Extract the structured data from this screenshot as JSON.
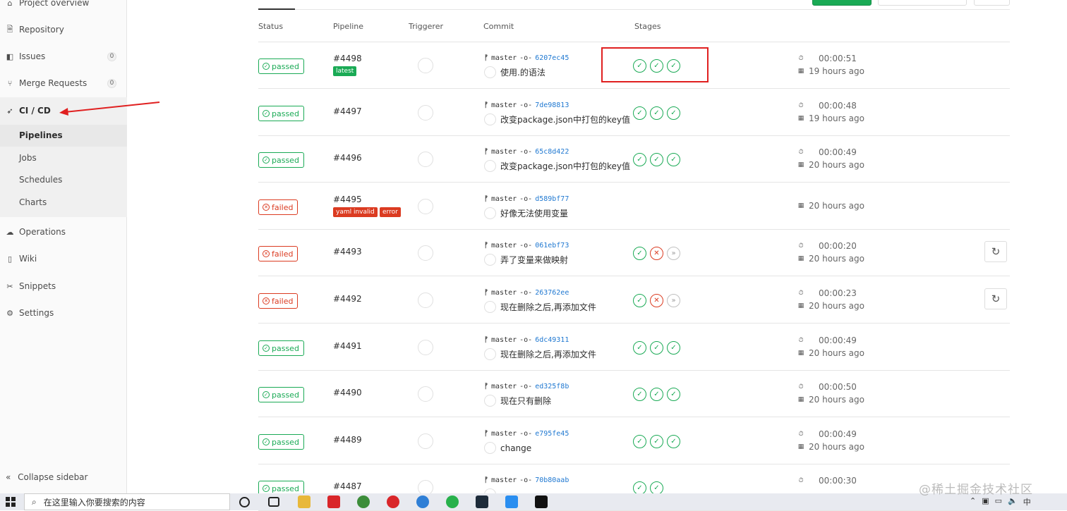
{
  "sidebar": {
    "items": [
      {
        "label": "Project overview",
        "icon": "home-icon"
      },
      {
        "label": "Repository",
        "icon": "document-icon"
      },
      {
        "label": "Issues",
        "icon": "issues-icon",
        "count": "0"
      },
      {
        "label": "Merge Requests",
        "icon": "merge-request-icon",
        "count": "0"
      },
      {
        "label": "CI / CD",
        "icon": "rocket-icon"
      },
      {
        "label": "Operations",
        "icon": "cloud-icon"
      },
      {
        "label": "Wiki",
        "icon": "book-icon"
      },
      {
        "label": "Snippets",
        "icon": "scissors-icon"
      },
      {
        "label": "Settings",
        "icon": "gear-icon"
      }
    ],
    "cicd_sub": [
      "Pipelines",
      "Jobs",
      "Schedules",
      "Charts"
    ],
    "collapse_label": "Collapse sidebar"
  },
  "table": {
    "headers": [
      "Status",
      "Pipeline",
      "Triggerer",
      "Commit",
      "Stages"
    ],
    "rows": [
      {
        "status": "passed",
        "id": "#4498",
        "tags": [
          "latest"
        ],
        "ref": "master",
        "sha": "6207ec45",
        "message": "使用.的语法",
        "stages": [
          "success",
          "success",
          "success"
        ],
        "duration": "00:00:51",
        "finished": "19 hours ago",
        "retry": false
      },
      {
        "status": "passed",
        "id": "#4497",
        "tags": [],
        "ref": "master",
        "sha": "7de98813",
        "message": "改变package.json中打包的key值",
        "stages": [
          "success",
          "success",
          "success"
        ],
        "duration": "00:00:48",
        "finished": "19 hours ago",
        "retry": false
      },
      {
        "status": "passed",
        "id": "#4496",
        "tags": [],
        "ref": "master",
        "sha": "65c8d422",
        "message": "改变package.json中打包的key值",
        "stages": [
          "success",
          "success",
          "success"
        ],
        "duration": "00:00:49",
        "finished": "20 hours ago",
        "retry": false
      },
      {
        "status": "failed",
        "id": "#4495",
        "tags": [
          "yaml invalid",
          "error"
        ],
        "ref": "master",
        "sha": "d589bf77",
        "message": "好像无法使用变量",
        "stages": [],
        "duration": "",
        "finished": "20 hours ago",
        "retry": false
      },
      {
        "status": "failed",
        "id": "#4493",
        "tags": [],
        "ref": "master",
        "sha": "061ebf73",
        "message": "弄了变量来做映射",
        "stages": [
          "success",
          "failed",
          "skipped"
        ],
        "duration": "00:00:20",
        "finished": "20 hours ago",
        "retry": true
      },
      {
        "status": "failed",
        "id": "#4492",
        "tags": [],
        "ref": "master",
        "sha": "263762ee",
        "message": "现在删除之后,再添加文件",
        "stages": [
          "success",
          "failed",
          "skipped"
        ],
        "duration": "00:00:23",
        "finished": "20 hours ago",
        "retry": true
      },
      {
        "status": "passed",
        "id": "#4491",
        "tags": [],
        "ref": "master",
        "sha": "6dc49311",
        "message": "现在删除之后,再添加文件",
        "stages": [
          "success",
          "success",
          "success"
        ],
        "duration": "00:00:49",
        "finished": "20 hours ago",
        "retry": false
      },
      {
        "status": "passed",
        "id": "#4490",
        "tags": [],
        "ref": "master",
        "sha": "ed325f8b",
        "message": "现在只有删除",
        "stages": [
          "success",
          "success",
          "success"
        ],
        "duration": "00:00:50",
        "finished": "20 hours ago",
        "retry": false
      },
      {
        "status": "passed",
        "id": "#4489",
        "tags": [],
        "ref": "master",
        "sha": "e795fe45",
        "message": "change",
        "stages": [
          "success",
          "success",
          "success"
        ],
        "duration": "00:00:49",
        "finished": "20 hours ago",
        "retry": false
      },
      {
        "status": "passed",
        "id": "#4487",
        "tags": [],
        "ref": "master",
        "sha": "70b80aab",
        "message": "",
        "stages": [
          "success",
          "success"
        ],
        "duration": "00:00:30",
        "finished": "",
        "retry": false
      }
    ]
  },
  "taskbar": {
    "search_placeholder": "在这里输入你要搜索的内容",
    "tray_text": "中"
  },
  "watermark": "@稀土掘金技术社区",
  "colors": {
    "success": "#1aaa55",
    "failed": "#db3b21",
    "link": "#1f78d1",
    "highlight": "#e02020"
  }
}
